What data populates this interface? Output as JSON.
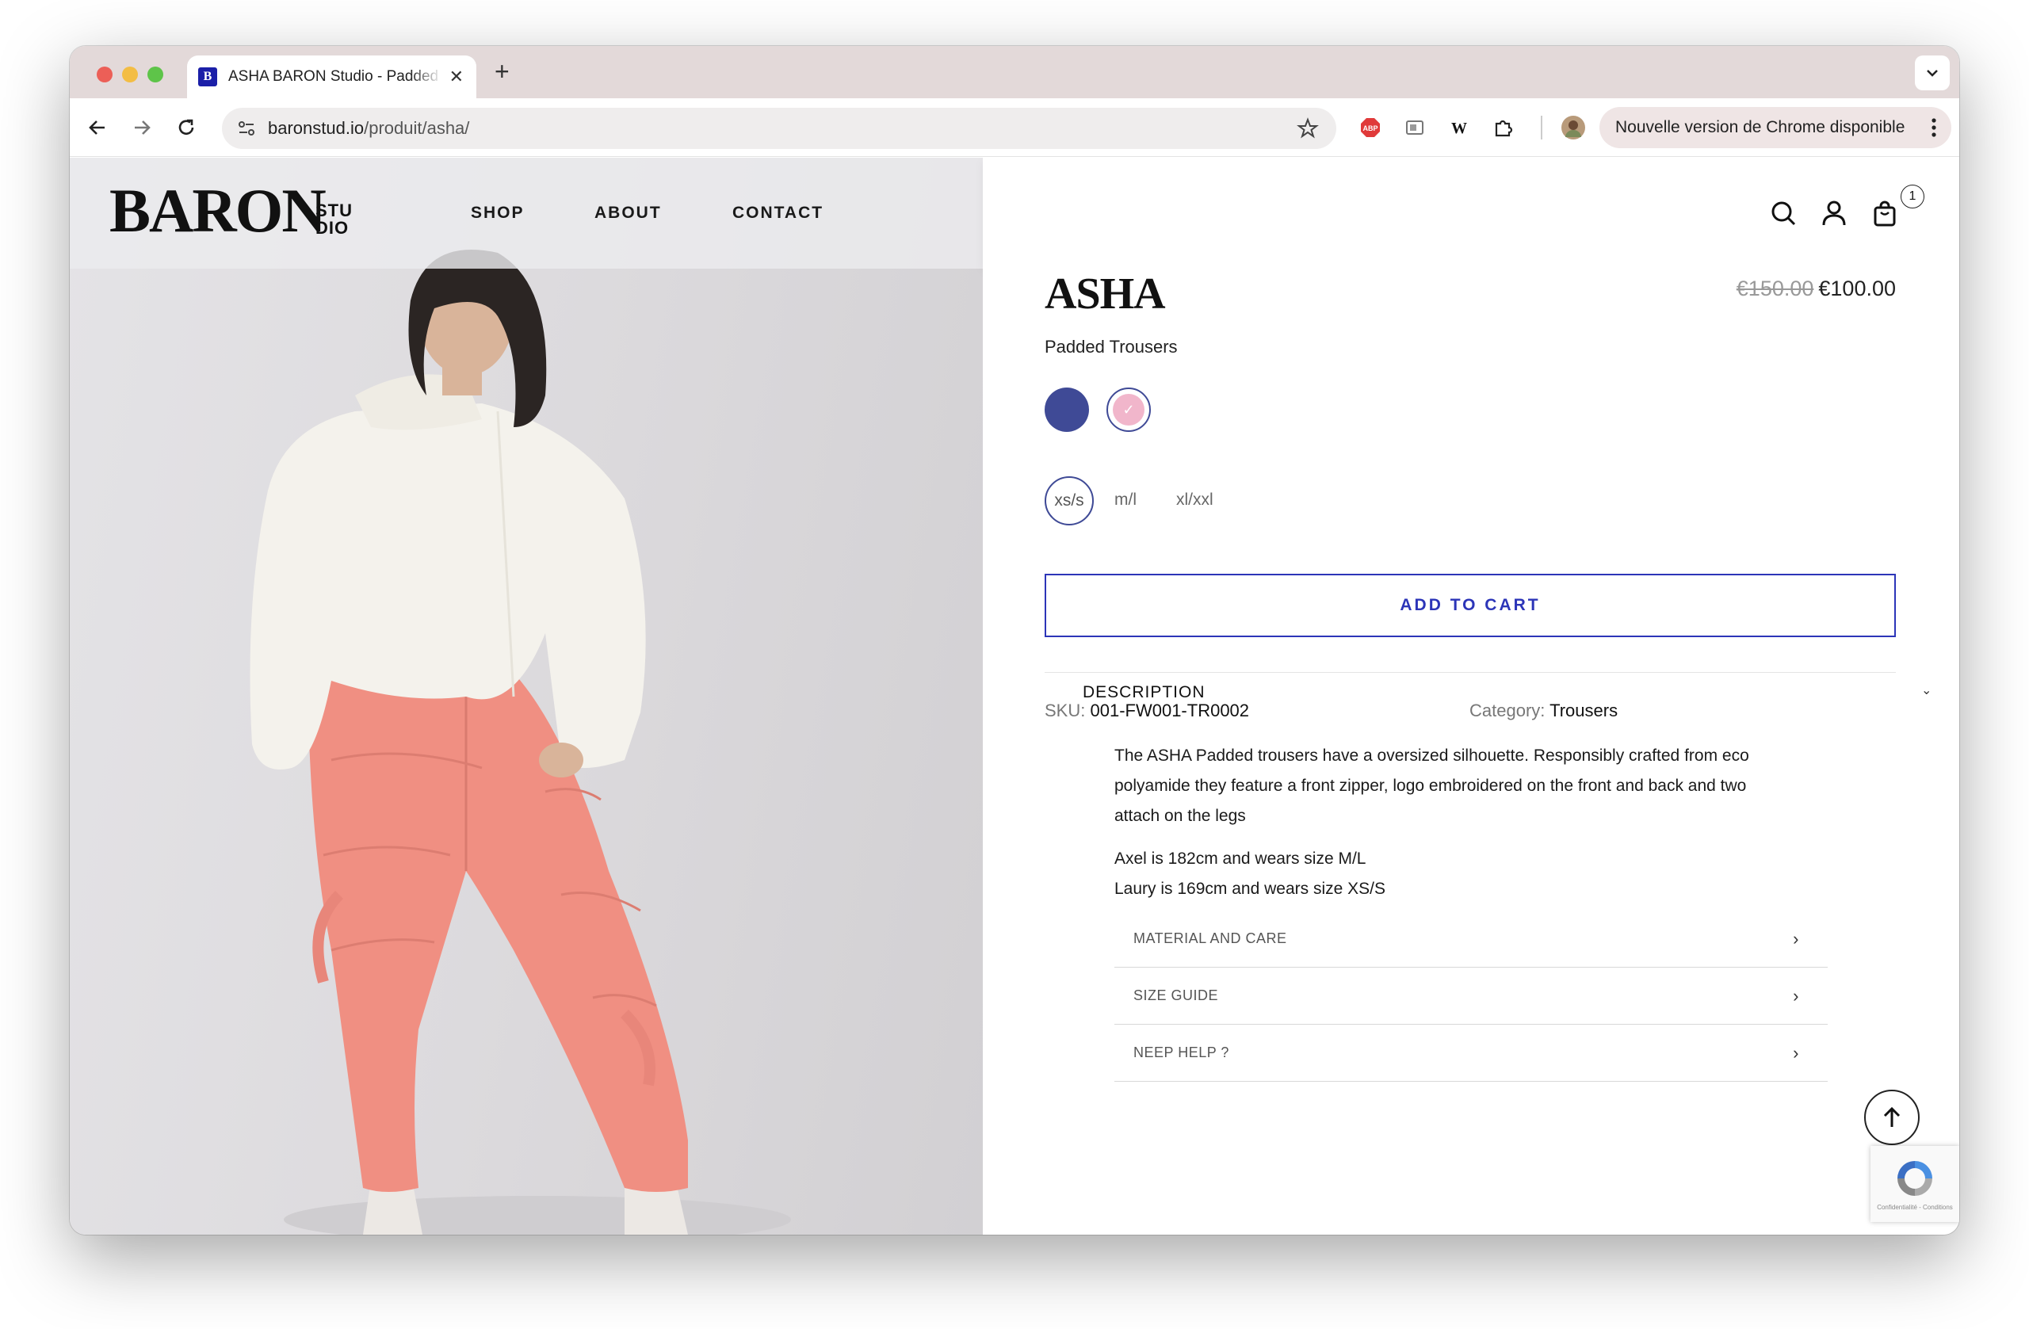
{
  "browser": {
    "tab_title": "ASHA BARON Studio - Padded Trousers",
    "tab_favicon": "B",
    "url_domain": "baronstud.io",
    "url_path": "/produit/asha/",
    "update_label": "Nouvelle version de Chrome disponible"
  },
  "site": {
    "logo_main": "BARON",
    "logo_sub_1": "STU",
    "logo_sub_2": "DIO",
    "nav": [
      "SHOP",
      "ABOUT",
      "CONTACT"
    ],
    "cart_count": "1"
  },
  "product": {
    "title": "ASHA",
    "old_price": "€150.00",
    "price": "€100.00",
    "subtitle": "Padded Trousers",
    "colors": [
      {
        "name": "blue",
        "hex": "#3f4a96",
        "selected": false
      },
      {
        "name": "pink",
        "hex": "#f1b6cb",
        "selected": true
      }
    ],
    "sizes": [
      "xs/s",
      "m/l",
      "xl/xxl"
    ],
    "selected_size": "xs/s",
    "add_to_cart": "ADD TO CART",
    "sku_label": "SKU:",
    "sku": "001-FW001-TR0002",
    "category_label": "Category:",
    "category": "Trousers",
    "description_header": "DESCRIPTION",
    "description_p1": "The ASHA Padded trousers have a oversized silhouette. Responsibly crafted from eco polyamide they feature a front zipper, logo embroidered on the front and back and two attach on the legs",
    "description_p2a": "Axel is 182cm and wears size M/L",
    "description_p2b": "Laury is 169cm and wears size XS/S",
    "accordion": [
      "MATERIAL AND CARE",
      "SIZE GUIDE",
      "NEEP HELP ?"
    ]
  },
  "recaptcha_text": "Confidentialité - Conditions",
  "colors": {
    "accent": "#2c35b8",
    "swatch_blue": "#3f4a96",
    "swatch_pink": "#f1b6cb",
    "trousers": "#f08f82",
    "sweater": "#f4f2ec"
  }
}
